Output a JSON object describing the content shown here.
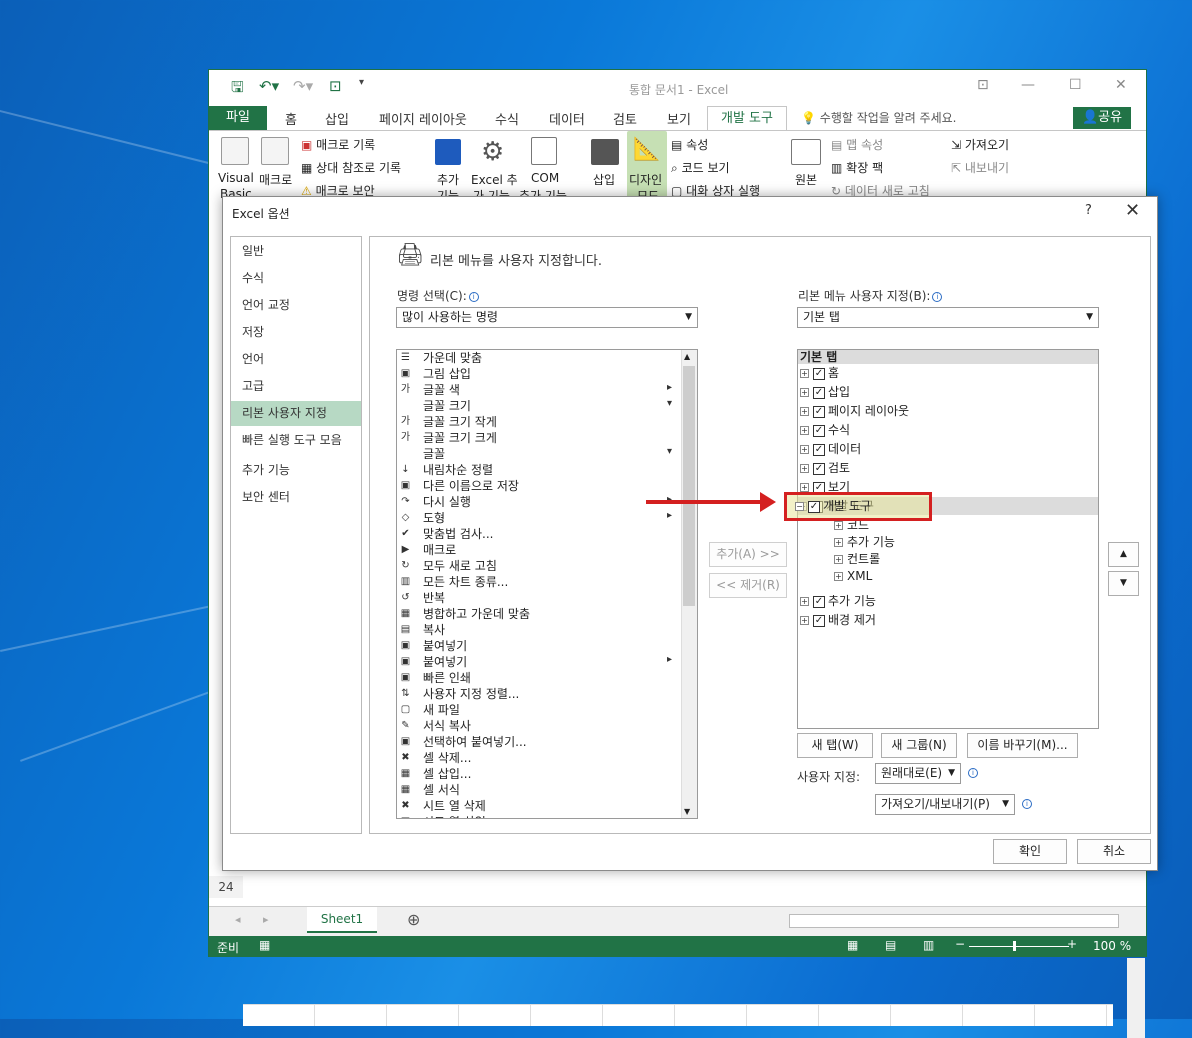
{
  "excel": {
    "title": "통합 문서1 - Excel",
    "tabs": {
      "file": "파일",
      "home": "홈",
      "insert": "삽입",
      "page_layout": "페이지 레이아웃",
      "formulas": "수식",
      "data": "데이터",
      "review": "검토",
      "view": "보기",
      "developer": "개발 도구"
    },
    "tell_me": "수행할 작업을 알려 주세요.",
    "share": "공유",
    "ribbon": {
      "visual_basic": "Visual\nBasic",
      "visual_basic_l1": "Visual",
      "visual_basic_l2": "Basic",
      "macros": "매크로",
      "record_macro": "매크로 기록",
      "relative_ref": "상대 참조로 기록",
      "macro_security": "매크로 보안",
      "addins": "추가",
      "addins_l2": "기능",
      "excel_addins": "Excel 추",
      "excel_addins_l2": "가 기능",
      "com": "COM",
      "com_l2": "추가 기능",
      "insert": "삽입",
      "design_mode": "디자인",
      "design_mode_l2": "모드",
      "properties": "속성",
      "view_code": "코드 보기",
      "run_dialog": "대화 상자 실행",
      "source": "원본",
      "map_props": "맵 속성",
      "expansion_packs": "확장 팩",
      "refresh_data": "데이터 새로 고침",
      "import": "가져오기",
      "export": "내보내기"
    },
    "row_24": "24",
    "sheet_tab": "Sheet1",
    "status": "준비",
    "zoom": "100 %"
  },
  "dialog": {
    "title": "Excel 옵션",
    "help": "?",
    "close": "✕",
    "nav": [
      "일반",
      "수식",
      "언어 교정",
      "저장",
      "언어",
      "고급",
      "리본 사용자 지정",
      "빠른 실행 도구 모음",
      "추가 기능",
      "보안 센터"
    ],
    "selected_nav": "리본 사용자 지정",
    "heading": "리본 메뉴를 사용자 지정합니다.",
    "choose_commands_label": "명령 선택(C):",
    "choose_commands_value": "많이 사용하는 명령",
    "customize_ribbon_label": "리본 메뉴 사용자 지정(B):",
    "customize_ribbon_value": "기본 탭",
    "commands": [
      "가운데 맞춤",
      "그림 삽입",
      "글꼴 색",
      "글꼴 크기",
      "글꼴 크기 작게",
      "글꼴 크기 크게",
      "글꼴",
      "내림차순 정렬",
      "다른 이름으로 저장",
      "다시 실행",
      "도형",
      "맞춤법 검사...",
      "매크로",
      "모두 새로 고침",
      "모든 차트 종류...",
      "반복",
      "병합하고 가운데 맞춤",
      "복사",
      "붙여넣기",
      "붙여넣기",
      "빠른 인쇄",
      "사용자 지정 정렬...",
      "새 파일",
      "서식 복사",
      "선택하여 붙여넣기...",
      "셀 삭제...",
      "셀 삽입...",
      "셀 서식",
      "시트 열 삭제",
      "시트 열 삽입"
    ],
    "tree_header": "기본 탭",
    "tree": [
      {
        "label": "홈",
        "level": 0,
        "expander": "⊞",
        "checked": true
      },
      {
        "label": "삽입",
        "level": 0,
        "expander": "⊞",
        "checked": true
      },
      {
        "label": "페이지 레이아웃",
        "level": 0,
        "expander": "⊞",
        "checked": true
      },
      {
        "label": "수식",
        "level": 0,
        "expander": "⊞",
        "checked": true
      },
      {
        "label": "데이터",
        "level": 0,
        "expander": "⊞",
        "checked": true
      },
      {
        "label": "검토",
        "level": 0,
        "expander": "⊞",
        "checked": true
      },
      {
        "label": "보기",
        "level": 0,
        "expander": "⊞",
        "checked": true
      },
      {
        "label": "개발 도구",
        "level": 0,
        "expander": "⊟",
        "checked": true
      },
      {
        "label": "코드",
        "level": 1,
        "expander": "⊞",
        "checked": null
      },
      {
        "label": "추가 기능",
        "level": 1,
        "expander": "⊞",
        "checked": null
      },
      {
        "label": "컨트롤",
        "level": 1,
        "expander": "⊞",
        "checked": null
      },
      {
        "label": "XML",
        "level": 1,
        "expander": "⊞",
        "checked": null
      },
      {
        "label": "추가 기능",
        "level": 0,
        "expander": "⊞",
        "checked": true
      },
      {
        "label": "배경 제거",
        "level": 0,
        "expander": "⊞",
        "checked": true
      }
    ],
    "add_button": "추가(A) >>",
    "remove_button": "<< 제거(R)",
    "up": "▲",
    "down": "▼",
    "new_tab": "새 탭(W)",
    "new_group": "새 그룹(N)",
    "rename": "이름 바꾸기(M)...",
    "customizations_label": "사용자 지정:",
    "reset": "원래대로(E)",
    "import_export": "가져오기/내보내기(P)",
    "ok": "확인",
    "cancel": "취소"
  },
  "colors": {
    "excel_green": "#217346",
    "highlight": "#e8e59a",
    "arrow": "#d42020"
  }
}
